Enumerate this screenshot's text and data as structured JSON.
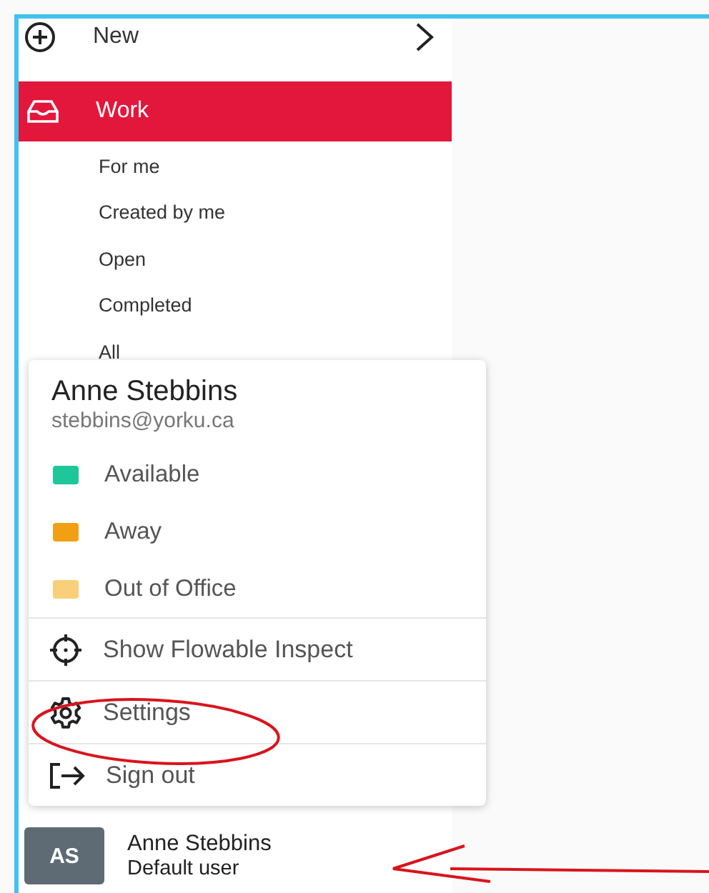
{
  "sidebar": {
    "items": [
      {
        "label": "New",
        "kind": "new",
        "selected": false
      },
      {
        "label": "Work",
        "kind": "work",
        "selected": true
      }
    ],
    "subitems": [
      "For me",
      "Created by me",
      "Open",
      "Completed",
      "All"
    ]
  },
  "user_menu": {
    "name": "Anne Stebbins",
    "email": "stebbins@yorku.ca",
    "statuses": [
      {
        "label": "Available",
        "color": "#1dc79a"
      },
      {
        "label": "Away",
        "color": "#f0a012"
      },
      {
        "label": "Out of Office",
        "color": "#f9cf7a"
      }
    ],
    "actions": [
      {
        "label": "Show Flowable Inspect",
        "kind": "inspect"
      },
      {
        "label": "Settings",
        "kind": "settings"
      },
      {
        "label": "Sign out",
        "kind": "signout"
      }
    ]
  },
  "user": {
    "initials": "AS",
    "name": "Anne Stebbins",
    "role": "Default user"
  }
}
